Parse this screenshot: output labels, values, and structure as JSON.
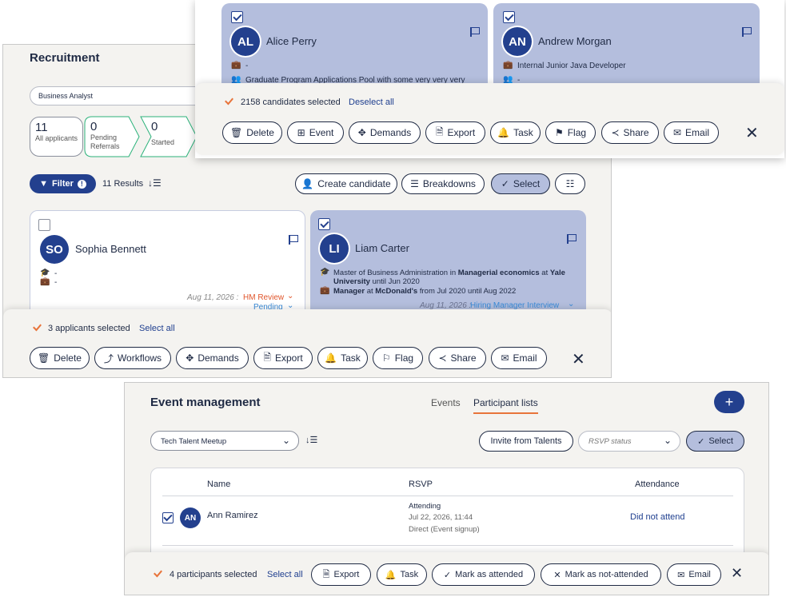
{
  "recruitment": {
    "title": "Recruitment",
    "job_select": "Business Analyst",
    "stats": [
      {
        "count": "11",
        "label": "All applicants"
      },
      {
        "count": "0",
        "label": "Pending Referrals"
      },
      {
        "count": "0",
        "label": "Started"
      }
    ],
    "filter_label": "Filter",
    "results_text": "11 Results",
    "toolbar": {
      "create": "Create candidate",
      "breakdowns": "Breakdowns",
      "select": "Select"
    },
    "cards": [
      {
        "initials": "SO",
        "name": "Sophia Bennett",
        "line1": "-",
        "line2": "-",
        "date": "Aug 11, 2026 :",
        "stage": "HM Review",
        "status": "Pending",
        "selected": false
      },
      {
        "initials": "LI",
        "name": "Liam Carter",
        "edu_pre": "Master of Business Administration in ",
        "edu_bold": "Managerial economics",
        "edu_mid": " at ",
        "edu_school": "Yale University",
        "edu_post": " until Jun 2020",
        "job_bold": "Manager",
        "job_mid": " at ",
        "job_company": "McDonald's",
        "job_post": " from Jul 2020 until Aug 2022",
        "date": "Aug 11, 2026 :",
        "stage": "Hiring Manager Interview",
        "selected": true
      }
    ],
    "bar": {
      "selected_text": "3 applicants selected",
      "select_all": "Select all",
      "actions": [
        "Delete",
        "Workflows",
        "Demands",
        "Export",
        "Task",
        "Flag",
        "Share",
        "Email"
      ]
    }
  },
  "talent_pool": {
    "cards": [
      {
        "initials": "AL",
        "name": "Alice Perry",
        "line1": "-",
        "line2": "Graduate Program Applications Pool with some very very very"
      },
      {
        "initials": "AN",
        "name": "Andrew Morgan",
        "line1": "Internal Junior Java Developer",
        "line2": "-"
      }
    ],
    "bar": {
      "selected_text": "2158 candidates selected",
      "deselect_all": "Deselect all",
      "actions": [
        "Delete",
        "Event",
        "Demands",
        "Export",
        "Task",
        "Flag",
        "Share",
        "Email"
      ]
    }
  },
  "events": {
    "title": "Event management",
    "tabs": [
      "Events",
      "Participant lists"
    ],
    "active_tab": "Participant lists",
    "event_select": "Tech Talent Meetup",
    "invite_label": "Invite from Talents",
    "rsvp_placeholder": "RSVP status",
    "select_label": "Select",
    "add_label": "+",
    "columns": [
      "Name",
      "RSVP",
      "Attendance"
    ],
    "rows": [
      {
        "initials": "AN",
        "name": "Ann Ramirez",
        "rsvp": "Attending",
        "rsvp_date": "Jul 22, 2026, 11:44",
        "rsvp_source": "Direct (Event signup)",
        "attendance": "Did not attend"
      }
    ],
    "bar": {
      "selected_text": "4 participants selected",
      "select_all": "Select all",
      "actions": [
        "Export",
        "Task",
        "Mark as attended",
        "Mark as not-attended",
        "Email"
      ]
    }
  },
  "colors": {
    "navy": "#23408e",
    "card_selected": "#b4bedd",
    "accent_orange": "#e8743b",
    "panel_bg": "#f4f3f0"
  }
}
